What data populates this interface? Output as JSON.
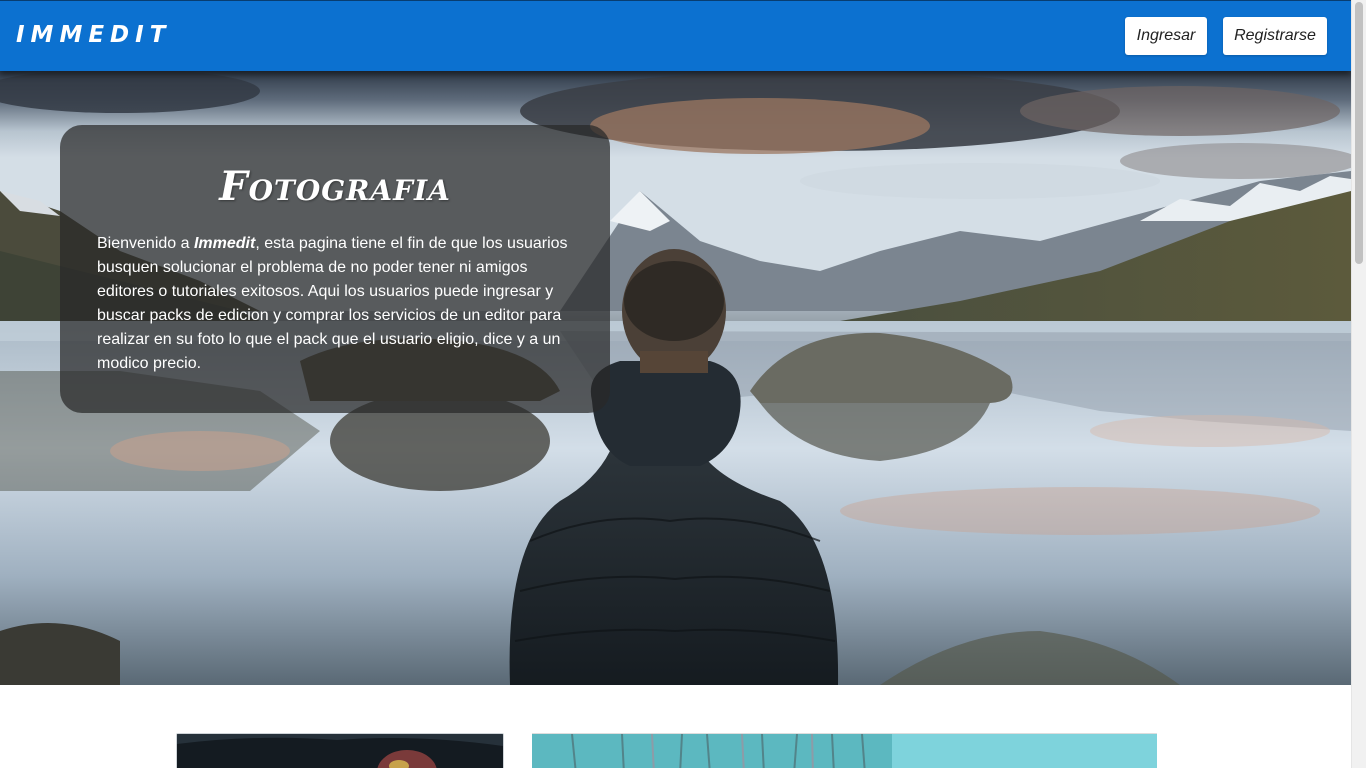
{
  "brand": {
    "name": "IMMEDIT"
  },
  "navbar": {
    "login_label": "Ingresar",
    "register_label": "Registrarse",
    "background_color": "#0c71d0"
  },
  "hero": {
    "title": "Fotografia",
    "text_prefix": "Bienvenido a ",
    "text_brand": "Immedit",
    "text_body": ", esta pagina tiene el fin de que los usuarios busquen solucionar el problema de no poder tener ni amigos editores o tutoriales exitosos. Aqui los usuarios puede ingresar y buscar packs de edicion y comprar los servicios de un editor para realizar en su foto lo que el pack que el usuario eligio, dice y a un modico precio.",
    "image": "person-with-hood-facing-mountain-lake"
  },
  "gallery": {
    "images": [
      "motorcycle-helmet-photo",
      "turquoise-forest-photo"
    ]
  }
}
